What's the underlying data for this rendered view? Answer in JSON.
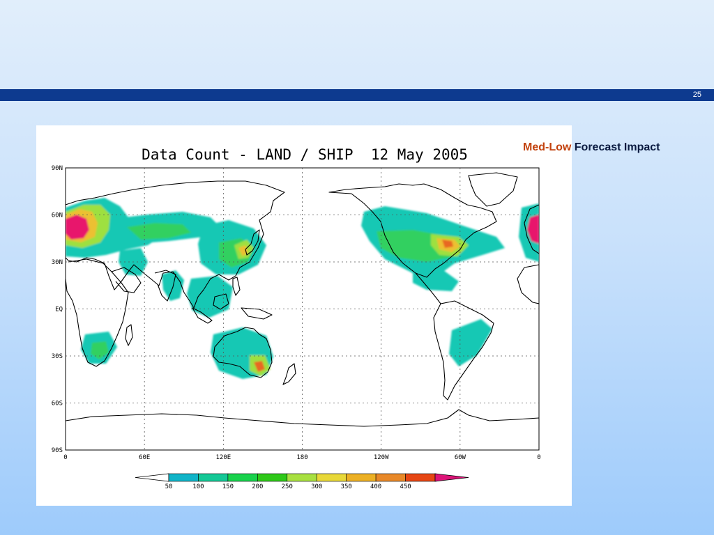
{
  "slide": {
    "page_number": "25",
    "impact_level": "Med-Low",
    "impact_label": "Forecast Impact",
    "colors": {
      "bar": "#0d3a8f",
      "impact_level": "#c2410c",
      "impact_label": "#0a1a40"
    }
  },
  "map": {
    "title": "Data Count - LAND / SHIP  12 May 2005",
    "lat_ticks": [
      "90N",
      "60N",
      "30N",
      "EQ",
      "30S",
      "60S",
      "90S"
    ],
    "lon_ticks": [
      "0",
      "60E",
      "120E",
      "180",
      "120W",
      "60W",
      "0"
    ],
    "colorbar": {
      "labels": [
        "50",
        "100",
        "150",
        "200",
        "250",
        "300",
        "350",
        "400",
        "450"
      ],
      "colors": [
        "#10b4c8",
        "#14c896",
        "#18d24c",
        "#2ec818",
        "#a8e040",
        "#e8d838",
        "#ecb024",
        "#e88828",
        "#e64614",
        "#e0101c",
        "#dc1478"
      ]
    },
    "density_colors": {
      "low": "#14c8b4",
      "lowmid": "#30d060",
      "mid": "#9ee040",
      "high": "#ecc030",
      "veryhigh": "#e86820",
      "extreme": "#e8186c"
    }
  }
}
